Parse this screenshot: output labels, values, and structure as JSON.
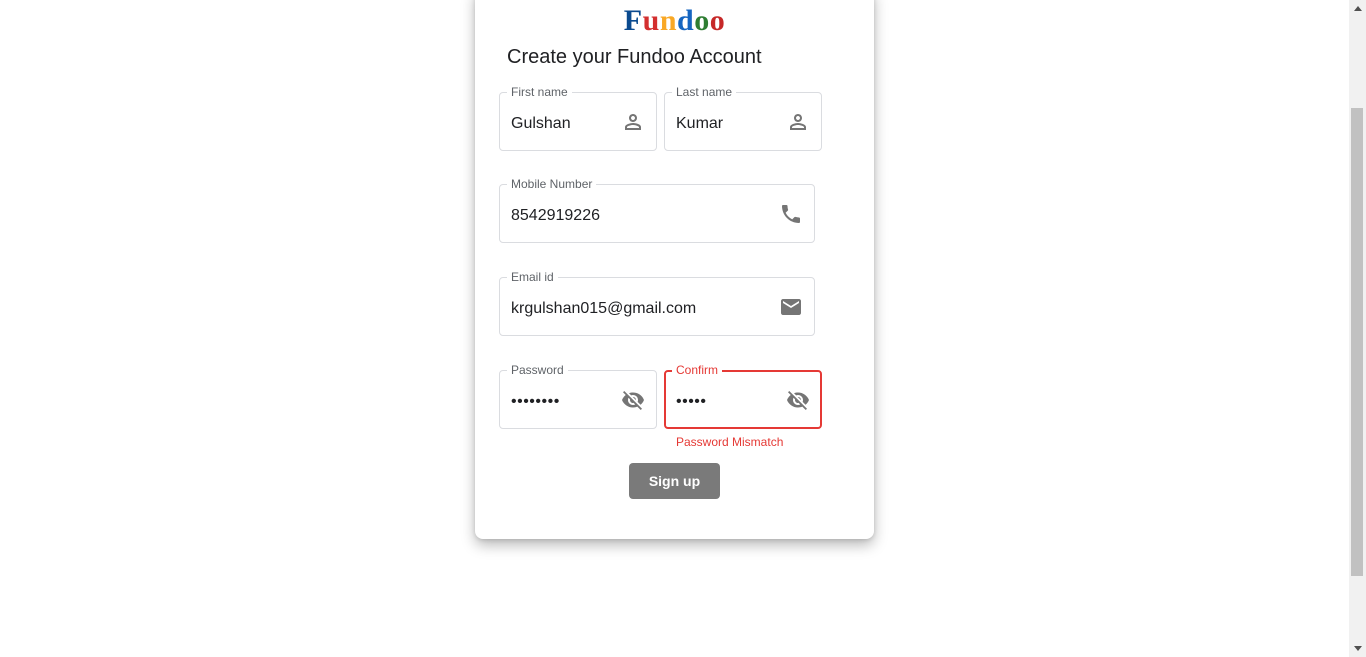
{
  "logo": {
    "letters": [
      {
        "char": "F",
        "color": "#0a4a8f"
      },
      {
        "char": "u",
        "color": "#d32f2f"
      },
      {
        "char": "n",
        "color": "#f9a825"
      },
      {
        "char": "d",
        "color": "#1565c0"
      },
      {
        "char": "o",
        "color": "#2e7d32"
      },
      {
        "char": "o",
        "color": "#c62828"
      }
    ]
  },
  "title": "Create your Fundoo Account",
  "fields": {
    "first_name": {
      "label": "First name",
      "value": "Gulshan",
      "icon": "person-icon"
    },
    "last_name": {
      "label": "Last name",
      "value": "Kumar",
      "icon": "person-icon"
    },
    "mobile": {
      "label": "Mobile Number",
      "value": "8542919226",
      "icon": "phone-icon"
    },
    "email": {
      "label": "Email id",
      "value": "krgulshan015@gmail.com",
      "icon": "mail-icon"
    },
    "password": {
      "label": "Password",
      "value": "••••••••",
      "icon": "eye-off-icon"
    },
    "confirm": {
      "label": "Confirm",
      "value": "•••••",
      "icon": "eye-off-icon"
    }
  },
  "error": {
    "confirm_message": "Password Mismatch",
    "color": "#e53935"
  },
  "signup_label": "Sign up"
}
